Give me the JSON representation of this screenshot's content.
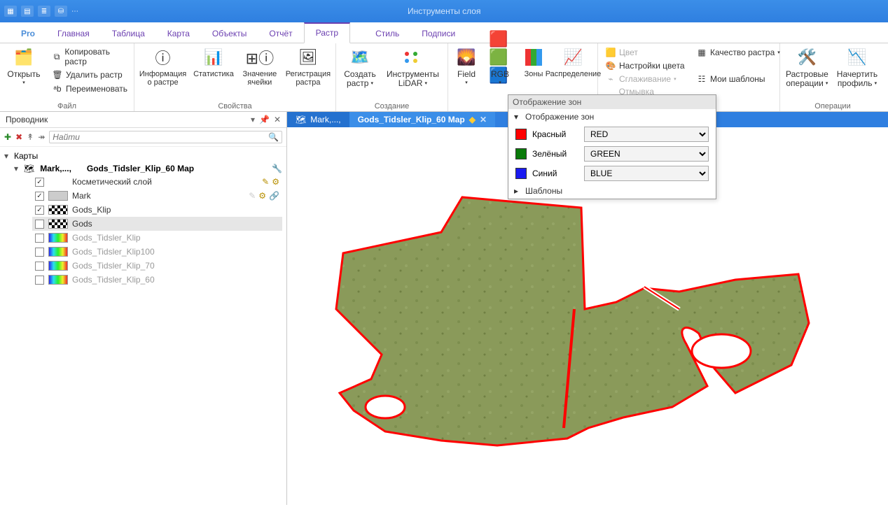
{
  "titlebar": {
    "context_title": "Инструменты слоя"
  },
  "tabs": {
    "pro": "Pro",
    "items": [
      "Главная",
      "Таблица",
      "Карта",
      "Объекты",
      "Отчёт",
      "Растр"
    ],
    "active": "Растр",
    "context": [
      "Стиль",
      "Подписи"
    ]
  },
  "ribbon": {
    "file": {
      "open": "Открыть",
      "label": "Файл",
      "copy_raster": "Копировать растр",
      "delete_raster": "Удалить растр",
      "rename": "Переименовать"
    },
    "props": {
      "info": "Информация\nо растре",
      "stats": "Статистика",
      "cell_value": "Значение\nячейки",
      "register": "Регистрация\nрастра",
      "label": "Свойства"
    },
    "create": {
      "create_raster": "Создать\nрастр",
      "lidar": "Инструменты\nLiDAR",
      "label": "Создание"
    },
    "mid": {
      "field": "Field",
      "rgb": "RGB",
      "zones": "Зоны",
      "distribution": "Распределение"
    },
    "style": {
      "color": "Цвет",
      "color_settings": "Настройки цвета",
      "smoothing": "Сглаживание",
      "hillshade": "Отмывка рельефа",
      "raster_quality": "Качество растра",
      "my_templates": "Мои шаблоны"
    },
    "ops": {
      "raster_ops": "Растровые\nоперации",
      "draw_profile": "Начертить\nпрофиль",
      "label": "Операции"
    }
  },
  "sidebar": {
    "title": "Проводник",
    "search_placeholder": "Найти",
    "maps_label": "Карты",
    "map_root": "Mark,...,",
    "map_title": "Gods_Tidsler_Klip_60 Map",
    "cosmetic": "Косметический слой",
    "rows": [
      {
        "name": "Mark",
        "checked": true
      },
      {
        "name": "Gods_Klip",
        "checked": true
      },
      {
        "name": "Gods",
        "checked": false,
        "selected": true
      },
      {
        "name": "Gods_Tidsler_Klip",
        "checked": false,
        "dim": true
      },
      {
        "name": "Gods_Tidsler_Klip100",
        "checked": false,
        "dim": true
      },
      {
        "name": "Gods_Tidsler_Klip_70",
        "checked": false,
        "dim": true
      },
      {
        "name": "Gods_Tidsler_Klip_60",
        "checked": false,
        "dim": true
      }
    ]
  },
  "maptabs": {
    "first": "Mark,...,",
    "selected": "Gods_Tidsler_Klip_60 Map"
  },
  "popup": {
    "title": "Отображение зон",
    "section": "Отображение зон",
    "templates": "Шаблоны",
    "red_label": "Красный",
    "red_value": "RED",
    "green_label": "Зелёный",
    "green_value": "GREEN",
    "blue_label": "Синий",
    "blue_value": "BLUE"
  },
  "colors": {
    "red": "#ff0000",
    "green": "#0a7a0a",
    "blue": "#1a1af0"
  }
}
